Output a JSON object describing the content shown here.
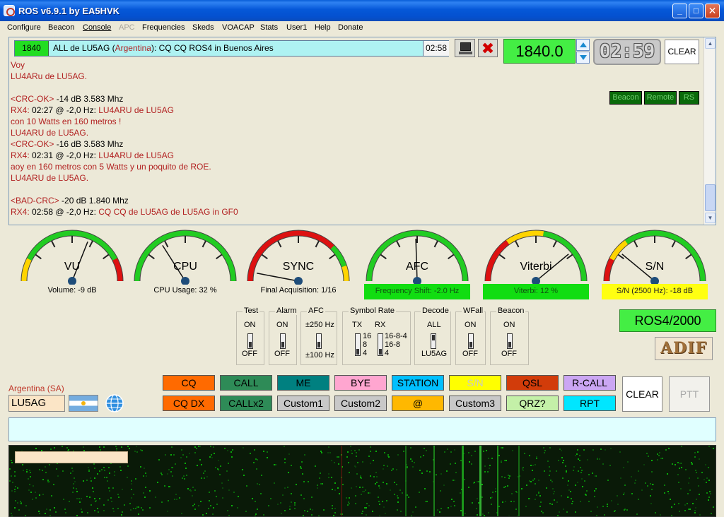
{
  "window": {
    "title": "ROS v6.9.1 by EA5HVK",
    "min_label": "_",
    "max_label": "□",
    "close_label": "✕"
  },
  "menu": [
    "Configure",
    "Beacon",
    "Console",
    "APC",
    "Frequencies",
    "Skeds",
    "VOACAP",
    "Stats",
    "User1",
    "Help",
    "Donate"
  ],
  "banner": {
    "freq": "1840",
    "msg_prefix": "ALL de LU5AG (",
    "msg_country": "Argentina",
    "msg_suffix": "): CQ CQ ROS4 in Buenos Aires",
    "time": "02:58"
  },
  "freq_display": "1840.0",
  "timer": "02:59",
  "clear_top": "CLEAR",
  "small_buttons": {
    "beacon": "Beacon",
    "remote": "Remote",
    "rs": "RS"
  },
  "console": [
    {
      "parts": [
        {
          "t": "Voy",
          "c": "red"
        }
      ]
    },
    {
      "parts": [
        {
          "t": "LU4ARu de LU5AG.",
          "c": "red"
        }
      ]
    },
    {
      "parts": [
        {
          "t": "",
          "c": "blk"
        }
      ]
    },
    {
      "parts": [
        {
          "t": " <CRC-OK>",
          "c": "red"
        },
        {
          "t": " -14 dB  3.583 Mhz",
          "c": "blk"
        }
      ]
    },
    {
      "parts": [
        {
          "t": "RX4:",
          "c": "red"
        },
        {
          "t": " 02:27 @ -2,0 Hz: ",
          "c": "blk"
        },
        {
          "t": "LU4ARU de LU5AG",
          "c": "red"
        }
      ]
    },
    {
      "parts": [
        {
          "t": "con 10 Watts en 160 metros !",
          "c": "red"
        }
      ]
    },
    {
      "parts": [
        {
          "t": "LU4ARU de LU5AG.",
          "c": "red"
        }
      ]
    },
    {
      "parts": [
        {
          "t": " <CRC-OK>",
          "c": "red"
        },
        {
          "t": " -16 dB  3.583 Mhz",
          "c": "blk"
        }
      ]
    },
    {
      "parts": [
        {
          "t": "RX4:",
          "c": "red"
        },
        {
          "t": " 02:31 @ -2,0 Hz: ",
          "c": "blk"
        },
        {
          "t": "LU4ARU de LU5AG",
          "c": "red"
        }
      ]
    },
    {
      "parts": [
        {
          "t": "aoy en 160 metros con 5 Watts y un poquito de ROE.",
          "c": "red"
        }
      ]
    },
    {
      "parts": [
        {
          "t": "LU4ARU de LU5AG.",
          "c": "red"
        }
      ]
    },
    {
      "parts": [
        {
          "t": "",
          "c": "blk"
        }
      ]
    },
    {
      "parts": [
        {
          "t": " <BAD-CRC>",
          "c": "red"
        },
        {
          "t": " -20 dB  1.840 Mhz",
          "c": "blk"
        }
      ]
    },
    {
      "parts": [
        {
          "t": "RX4:",
          "c": "red"
        },
        {
          "t": " 02:58 @ -2,0 Hz: ",
          "c": "blk"
        },
        {
          "t": "CQ CQ de LU5AG de LU5AG in GF0",
          "c": "red"
        }
      ]
    }
  ],
  "gauges": [
    {
      "name": "vu",
      "label": "VU",
      "caption": "Volume: -9 dB",
      "style": "plain",
      "scheme": "vu",
      "level": 0.62
    },
    {
      "name": "cpu",
      "label": "CPU",
      "caption": "CPU Usage: 32 %",
      "style": "plain",
      "scheme": "cpu",
      "level": 0.32
    },
    {
      "name": "sync",
      "label": "SYNC",
      "caption": "Final Acquisition: 1/16",
      "style": "plain",
      "scheme": "sync",
      "level": 0.06
    },
    {
      "name": "afc",
      "label": "AFC",
      "caption": "Frequency Shift: -2.0 Hz",
      "style": "green",
      "scheme": "afc",
      "level": 0.49
    },
    {
      "name": "viterbi",
      "label": "Viterbi",
      "caption": "Viterbi: 12 %",
      "style": "green",
      "scheme": "viterbi",
      "level": 0.78
    },
    {
      "name": "sn",
      "label": "S/N",
      "caption": "S/N (2500 Hz): -18 dB",
      "style": "yellow",
      "scheme": "sn",
      "level": 0.22
    }
  ],
  "toggles": {
    "test": {
      "title": "Test",
      "top": "ON",
      "bottom": "OFF"
    },
    "alarm": {
      "title": "Alarm",
      "top": "ON",
      "bottom": "OFF"
    },
    "afc": {
      "title": "AFC",
      "top": "±250 Hz",
      "bottom": "±100 Hz"
    },
    "symbol_rate": {
      "title": "Symbol Rate",
      "tx": "TX",
      "rx": "RX",
      "tx_opts": [
        "16",
        "8",
        "4"
      ],
      "rx_opts": [
        "16-8-4",
        "16-8",
        "4"
      ]
    },
    "decode": {
      "title": "Decode",
      "top": "ALL",
      "bottom": "LU5AG"
    },
    "wfall": {
      "title": "WFall",
      "top": "ON",
      "bottom": "OFF"
    },
    "beacon": {
      "title": "Beacon",
      "top": "ON",
      "bottom": "OFF"
    }
  },
  "mode": "ROS4/2000",
  "adif": "ADIF",
  "station": {
    "country": "Argentina (SA)",
    "callsign": "LU5AG"
  },
  "macros": {
    "row1": [
      {
        "name": "cq",
        "label": "CQ",
        "bg": "#ff6a00",
        "fg": "#000"
      },
      {
        "name": "call",
        "label": "CALL",
        "bg": "#2e8b57",
        "fg": "#000"
      },
      {
        "name": "me",
        "label": "ME",
        "bg": "#008080",
        "fg": "#000"
      },
      {
        "name": "bye",
        "label": "BYE",
        "bg": "#ffa6d0",
        "fg": "#000"
      },
      {
        "name": "station",
        "label": "STATION",
        "bg": "#00bfff",
        "fg": "#000"
      },
      {
        "name": "sn",
        "label": "S/N",
        "bg": "#ffff00",
        "fg": "#c8c8c8"
      },
      {
        "name": "qsl",
        "label": "QSL",
        "bg": "#d23c0a",
        "fg": "#000"
      },
      {
        "name": "rcall",
        "label": "R-CALL",
        "bg": "#cba6f3",
        "fg": "#000"
      }
    ],
    "row2": [
      {
        "name": "cqdx",
        "label": "CQ DX",
        "bg": "#ff6a00",
        "fg": "#000"
      },
      {
        "name": "callx2",
        "label": "CALLx2",
        "bg": "#2e8b57",
        "fg": "#000"
      },
      {
        "name": "custom1",
        "label": "Custom1",
        "bg": "#c8c8c8",
        "fg": "#000"
      },
      {
        "name": "custom2",
        "label": "Custom2",
        "bg": "#c8c8c8",
        "fg": "#000"
      },
      {
        "name": "at",
        "label": "@",
        "bg": "#ffb800",
        "fg": "#000"
      },
      {
        "name": "custom3",
        "label": "Custom3",
        "bg": "#c8c8c8",
        "fg": "#000"
      },
      {
        "name": "qrz",
        "label": "QRZ?",
        "bg": "#c4f0a8",
        "fg": "#000"
      },
      {
        "name": "rpt",
        "label": "RPT",
        "bg": "#00e6ff",
        "fg": "#000"
      }
    ]
  },
  "clear": "CLEAR",
  "ptt": "PTT"
}
